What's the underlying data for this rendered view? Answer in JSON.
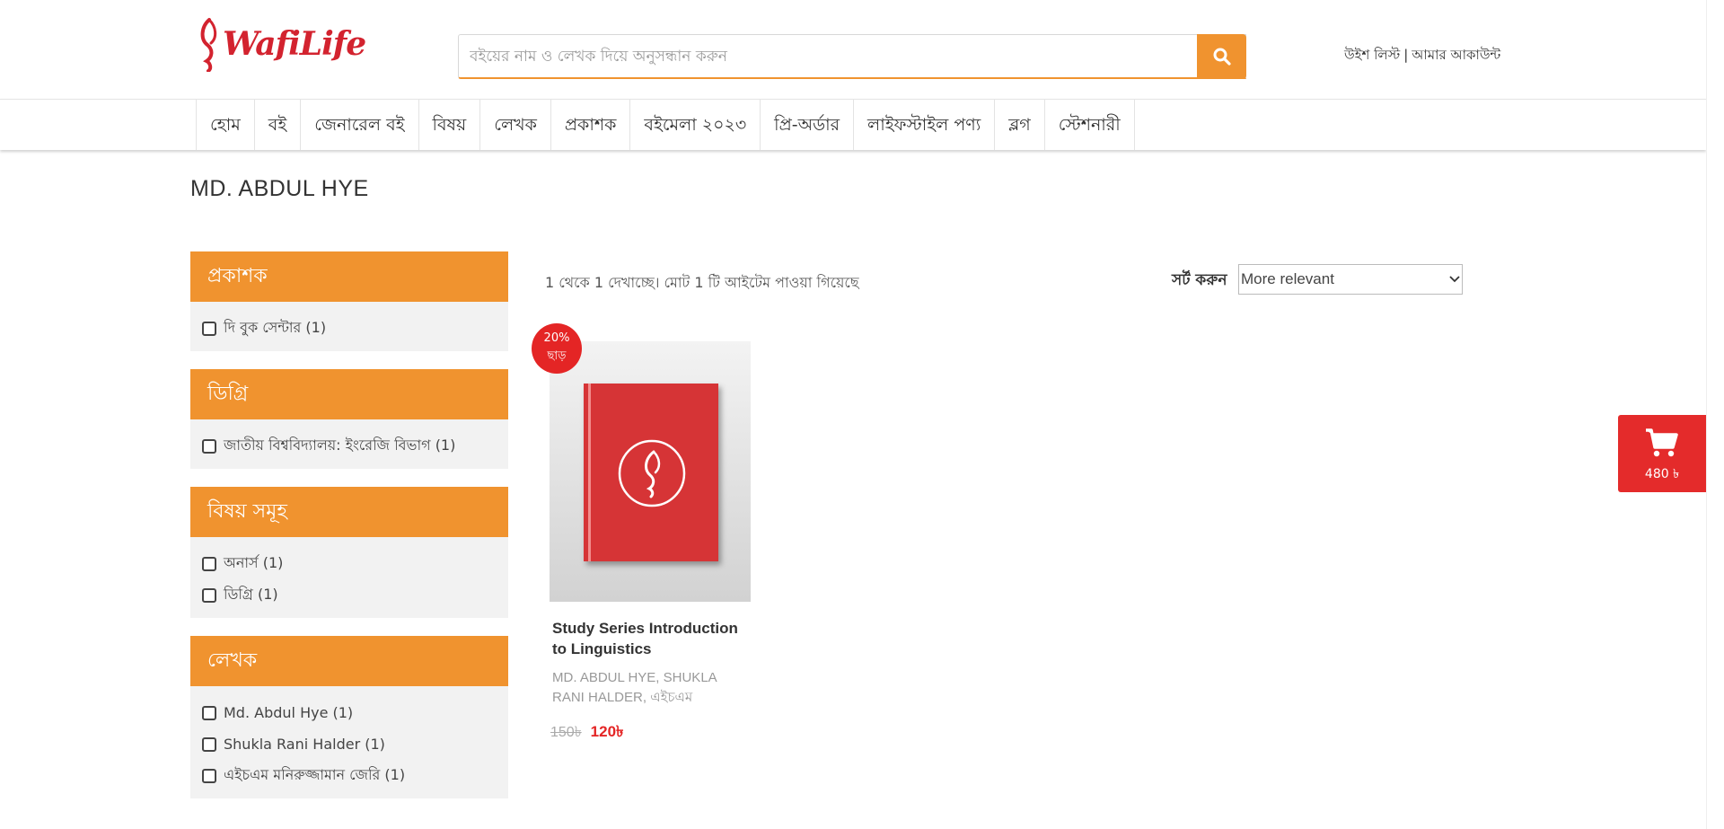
{
  "header": {
    "logo_text": "WafiLife",
    "search_placeholder": "বইয়ের নাম ও লেখক দিয়ে অনুসন্ধান করুন",
    "wishlist": "উইশ লিস্ট",
    "separator": "|",
    "account": "আমার আকাউন্ট"
  },
  "nav": {
    "items": [
      "হোম",
      "বই",
      "জেনারেল বই",
      "বিষয়",
      "লেখক",
      "প্রকাশক",
      "বইমেলা ২০২৩",
      "প্রি-অর্ডার",
      "লাইফস্টাইল পণ্য",
      "ব্লগ",
      "স্টেশনারী"
    ]
  },
  "page_title": "MD. ABDUL HYE",
  "filters": [
    {
      "title": "প্রকাশক",
      "items": [
        "দি বুক সেন্টার (1)"
      ]
    },
    {
      "title": "ডিগ্রি",
      "items": [
        "জাতীয় বিশ্ববিদ্যালয়: ইংরেজি বিভাগ (1)"
      ]
    },
    {
      "title": "বিষয় সমূহ",
      "items": [
        "অনার্স (1)",
        "ডিগ্রি (1)"
      ]
    },
    {
      "title": "লেখক",
      "items": [
        "Md. Abdul Hye (1)",
        "Shukla Rani Halder (1)",
        "এইচএম মনিরুজ্জামান জেরি (1)"
      ]
    }
  ],
  "results": {
    "count_text": "1 থেকে 1 দেখাচ্ছে। মোট 1 টি আইটেম পাওয়া গিয়েছে",
    "sort_label": "সর্ট করুন",
    "sort_value": "More relevant"
  },
  "product": {
    "badge_line1": "20%",
    "badge_line2": "ছাড়",
    "title": "Study Series Introduction to Linguistics",
    "authors": "MD. ABDUL HYE, SHUKLA RANI HALDER, এইচএম",
    "old_price": "150৳",
    "new_price": "120৳"
  },
  "cart": {
    "total": "480 ৳"
  },
  "colors": {
    "accent": "#f0932f",
    "brand_red": "#d3232f",
    "sale_red": "#e42525"
  },
  "icons": [
    "wafilife-logo-icon",
    "search-icon",
    "cart-icon",
    "chevron-down-icon",
    "checkbox-icon"
  ]
}
